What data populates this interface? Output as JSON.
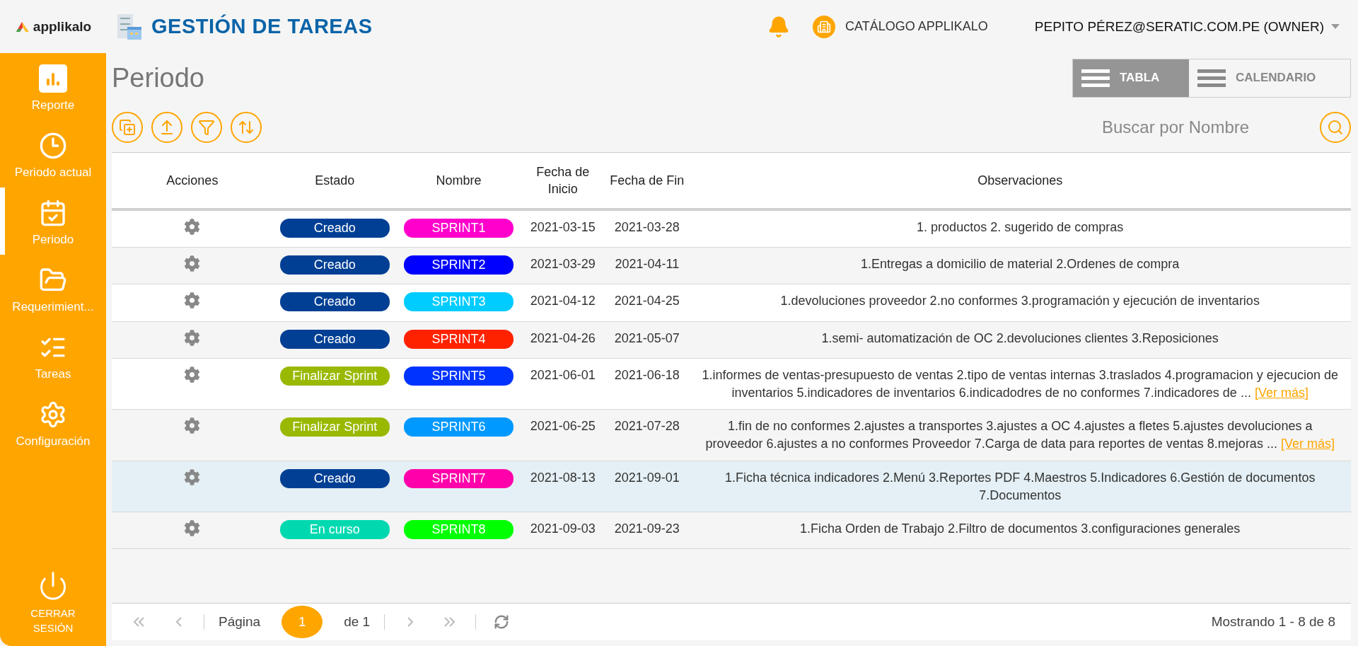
{
  "header": {
    "logo_text": "applikalo",
    "app_title": "GESTIÓN DE TAREAS",
    "catalog_link": "CATÁLOGO APPLIKALO",
    "user": "PEPITO PÉREZ@SERATIC.COM.PE (OWNER)"
  },
  "sidebar": {
    "items": [
      {
        "kind": "report",
        "label": "Reporte",
        "selected": false
      },
      {
        "kind": "clock",
        "label": "Periodo actual",
        "selected": false
      },
      {
        "kind": "calendar",
        "label": "Periodo",
        "selected": true
      },
      {
        "kind": "folder",
        "label": "Requerimient...",
        "selected": false
      },
      {
        "kind": "tasks",
        "label": "Tareas",
        "selected": false
      },
      {
        "kind": "settings",
        "label": "Configuración",
        "selected": false
      }
    ],
    "logout": "CERRAR SESIÓN"
  },
  "page": {
    "title": "Periodo",
    "view_tabs": [
      {
        "label": "TABLA",
        "selected": true
      },
      {
        "label": "CALENDARIO",
        "selected": false
      }
    ],
    "toolbar": [
      {
        "kind": "new"
      },
      {
        "kind": "upload"
      },
      {
        "kind": "filter"
      },
      {
        "kind": "sort"
      }
    ],
    "search": {
      "placeholder": "Buscar por Nombre"
    }
  },
  "table": {
    "columns": [
      "Acciones",
      "Estado",
      "Nombre",
      "Fecha de Inicio",
      "Fecha de Fin",
      "Observaciones"
    ],
    "rows": [
      {
        "selected": false,
        "status": {
          "text": "Creado",
          "color": "#003f94"
        },
        "name": {
          "text": "SPRINT1",
          "color": "#ff00cc"
        },
        "start": "2021-03-15",
        "end": "2021-03-28",
        "notes": "1. productos  2. sugerido de compras"
      },
      {
        "selected": false,
        "status": {
          "text": "Creado",
          "color": "#003f94"
        },
        "name": {
          "text": "SPRINT2",
          "color": "#0000ff"
        },
        "start": "2021-03-29",
        "end": "2021-04-11",
        "notes": "1.Entregas a domicilio de material 2.Ordenes de compra"
      },
      {
        "selected": false,
        "status": {
          "text": "Creado",
          "color": "#003f94"
        },
        "name": {
          "text": "SPRINT3",
          "color": "#00ccff"
        },
        "start": "2021-04-12",
        "end": "2021-04-25",
        "notes": "1.devoluciones proveedor 2.no conformes 3.programación y ejecución de inventarios"
      },
      {
        "selected": false,
        "status": {
          "text": "Creado",
          "color": "#003f94"
        },
        "name": {
          "text": "SPRINT4",
          "color": "#ff2200"
        },
        "start": "2021-04-26",
        "end": "2021-05-07",
        "notes": "1.semi- automatización de OC 2.devoluciones clientes 3.Reposiciones"
      },
      {
        "selected": false,
        "status": {
          "text": "Finalizar Sprint",
          "color": "#99b800"
        },
        "name": {
          "text": "SPRINT5",
          "color": "#0033ff"
        },
        "start": "2021-06-01",
        "end": "2021-06-18",
        "notes": "1.informes de ventas-presupuesto de ventas 2.tipo de ventas internas 3.traslados 4.programacion y ejecucion de inventarios 5.indicadores de inventarios 6.indicadodres de no conformes 7.indicadores de ...",
        "more": "[Ver más]"
      },
      {
        "selected": false,
        "status": {
          "text": "Finalizar Sprint",
          "color": "#99b800"
        },
        "name": {
          "text": "SPRINT6",
          "color": "#0099ff"
        },
        "start": "2021-06-25",
        "end": "2021-07-28",
        "notes": "1.fin de no conformes 2.ajustes a transportes 3.ajustes a OC 4.ajustes a fletes 5.ajustes devoluciones a proveedor 6.ajustes a no conformes Proveedor 7.Carga de data para reportes de ventas 8.mejoras ...",
        "more": "[Ver más]"
      },
      {
        "selected": true,
        "status": {
          "text": "Creado",
          "color": "#003f94"
        },
        "name": {
          "text": "SPRINT7",
          "color": "#ff00aa"
        },
        "start": "2021-08-13",
        "end": "2021-09-01",
        "notes": "1.Ficha técnica indicadores 2.Menú 3.Reportes PDF 4.Maestros 5.Indicadores 6.Gestión de documentos 7.Documentos"
      },
      {
        "selected": false,
        "status": {
          "text": "En curso",
          "color": "#00d9b0"
        },
        "name": {
          "text": "SPRINT8",
          "color": "#00ff00"
        },
        "start": "2021-09-03",
        "end": "2021-09-23",
        "notes": "1.Ficha Orden de Trabajo 2.Filtro de documentos 3.configuraciones generales"
      }
    ]
  },
  "pager": {
    "page_label": "Página",
    "page": "1",
    "of": "de 1",
    "summary": "Mostrando 1 - 8 de 8"
  }
}
